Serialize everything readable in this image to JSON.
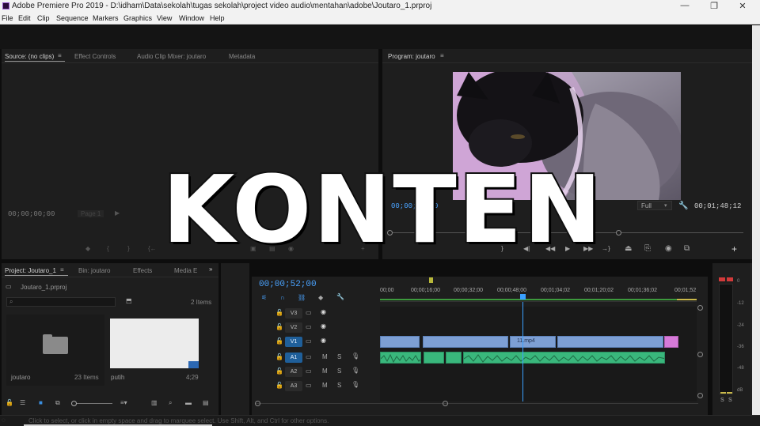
{
  "window": {
    "title": "Adobe Premiere Pro 2019 - D:\\idham\\Data\\sekolah\\tugas sekolah\\project video audio\\mentahan\\adobe\\Joutaro_1.prproj",
    "minimize": "—",
    "restore": "❐",
    "close": "✕"
  },
  "menu": [
    "File",
    "Edit",
    "Clip",
    "Sequence",
    "Markers",
    "Graphics",
    "View",
    "Window",
    "Help"
  ],
  "source_panel": {
    "tabs": [
      "Source: (no clips)",
      "Effect Controls",
      "Audio Clip Mixer: joutaro",
      "Metadata"
    ],
    "timecode": "00;00;00;00",
    "page": "Page 1"
  },
  "program_panel": {
    "tab": "Program: joutaro",
    "timecode_left": "00;00;52;00",
    "fit": "Full",
    "duration": "00;01;48;12"
  },
  "project_panel": {
    "tabs": [
      "Project: Joutaro_1",
      "Bin: joutaro",
      "Effects",
      "Media E"
    ],
    "file": "Joutaro_1.prproj",
    "item_count": "2 Items",
    "items": [
      {
        "name": "joutaro",
        "meta": "23 Items"
      },
      {
        "name": "putih",
        "meta": "4;29"
      }
    ]
  },
  "timeline": {
    "timecode": "00;00;52;00",
    "ruler": [
      "00;00",
      "00;00;16;00",
      "00;00;32;00",
      "00;00;48;00",
      "00;01;04;02",
      "00;01;20;02",
      "00;01;36;02",
      "00;01;52"
    ],
    "tracks": [
      {
        "name": "V3",
        "kind": "video",
        "target": false
      },
      {
        "name": "V2",
        "kind": "video",
        "target": false
      },
      {
        "name": "V1",
        "kind": "video",
        "target": true
      },
      {
        "name": "A1",
        "kind": "audio",
        "target": true
      },
      {
        "name": "A2",
        "kind": "audio",
        "target": false
      },
      {
        "name": "A3",
        "kind": "audio",
        "target": false
      }
    ],
    "clip_label": "11.mp4",
    "audio_btns": [
      "M",
      "S"
    ]
  },
  "meters": {
    "scale": [
      "0",
      "-12",
      "-24",
      "-36",
      "-48",
      "dB"
    ],
    "solo": [
      "S",
      "S"
    ]
  },
  "overlay": {
    "text": "KONTEN"
  },
  "status": {
    "text": "Click to select, or click in empty space and drag to marquee select. Use Shift, Alt, and Ctrl for other options."
  },
  "colors": {
    "accent": "#4aa3ff",
    "video_clip": "#7d9fd4",
    "audio_clip": "#39b77c",
    "end_clip": "#d67ad8"
  }
}
